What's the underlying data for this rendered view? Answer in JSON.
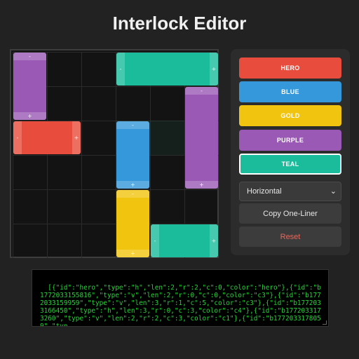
{
  "title": "Interlock Editor",
  "board": {
    "rows": 6,
    "cols": 6,
    "blocks": [
      {
        "id": "purple-topleft",
        "type": "v",
        "len": 2,
        "r": 0,
        "c": 0,
        "color": "#9b59b6",
        "label_a": "-",
        "label_b": "+"
      },
      {
        "id": "teal-top",
        "type": "h",
        "len": 3,
        "r": 0,
        "c": 3,
        "color": "#1abc9c",
        "label_a": "-",
        "label_b": "+"
      },
      {
        "id": "purple-right",
        "type": "v",
        "len": 3,
        "r": 1,
        "c": 5,
        "color": "#9b59b6",
        "label_a": "-",
        "label_b": "+"
      },
      {
        "id": "hero",
        "type": "h",
        "len": 2,
        "r": 2,
        "c": 0,
        "color": "#e74c3c",
        "label_a": "-",
        "label_b": "+"
      },
      {
        "id": "blue",
        "type": "v",
        "len": 2,
        "r": 2,
        "c": 3,
        "color": "#3498db",
        "label_a": "-",
        "label_b": "+"
      },
      {
        "id": "gold",
        "type": "v",
        "len": 2,
        "r": 4,
        "c": 3,
        "color": "#f1c40f",
        "label_a": "-",
        "label_b": "+"
      },
      {
        "id": "teal-bottom",
        "type": "h",
        "len": 2,
        "r": 5,
        "c": 4,
        "color": "#1abc9c",
        "label_a": "-",
        "label_b": "+"
      }
    ]
  },
  "palette": [
    {
      "label": "HERO",
      "color": "#e74c3c",
      "selected": false
    },
    {
      "label": "BLUE",
      "color": "#3498db",
      "selected": false
    },
    {
      "label": "GOLD",
      "color": "#f1c40f",
      "selected": false
    },
    {
      "label": "PURPLE",
      "color": "#9b59b6",
      "selected": false
    },
    {
      "label": "TEAL",
      "color": "#1abc9c",
      "selected": true
    }
  ],
  "orientation": {
    "value": "Horizontal"
  },
  "actions": {
    "copy": "Copy One-Liner",
    "reset": "Reset"
  },
  "output_text": "[{\"id\":\"hero\",\"type\":\"h\",\"len\":2,\"r\":2,\"c\":0,\"color\":\"hero\"},{\"id\":\"b1772033155816\",\"type\":\"v\",\"len\":2,\"r\":0,\"c\":0,\"color\":\"c3\"},{\"id\":\"b1772033159959\",\"type\":\"v\",\"len\":3,\"r\":1,\"c\":5,\"color\":\"c3\"},{\"id\":\"b1772033166450\",\"type\":\"h\",\"len\":3,\"r\":0,\"c\":3,\"color\":\"c4\"},{\"id\":\"b1772033173260\",\"type\":\"v\",\"len\":2,\"r\":2,\"c\":3,\"color\":\"c1\"},{\"id\":\"b1772033178059\",\"typ"
}
